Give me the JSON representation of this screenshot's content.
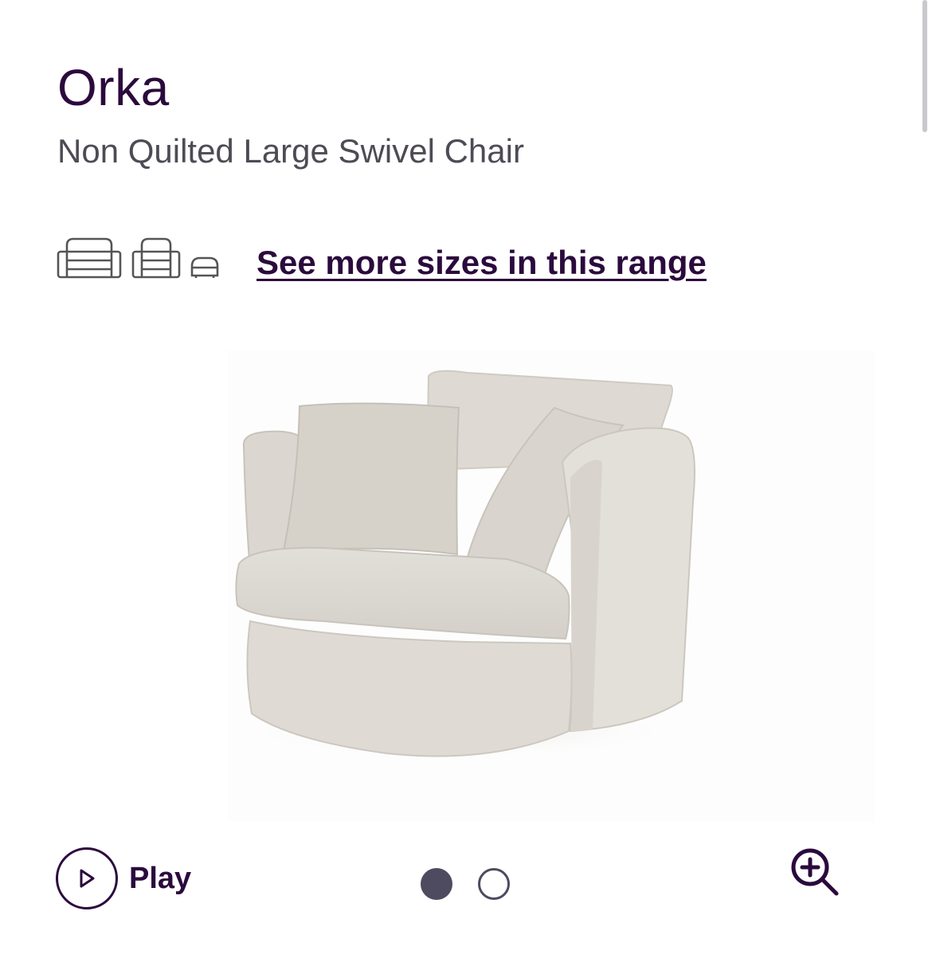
{
  "product": {
    "name": "Orka",
    "description": "Non Quilted Large Swivel Chair"
  },
  "range": {
    "link_label": "See more sizes in this range",
    "size_icons": [
      "sofa-icon",
      "armchair-icon",
      "footstool-icon"
    ]
  },
  "media": {
    "image_alt": "Orka Non Quilted Large Swivel Chair",
    "play_label": "Play",
    "slide_count": 2,
    "active_slide": 1
  },
  "colors": {
    "brand": "#2b0a3d",
    "text_secondary": "#4e4b55",
    "dot": "#4e4a5f",
    "upholstery": "#dcd8d1"
  },
  "icons": {
    "play": "play-icon",
    "zoom": "zoom-in-icon"
  }
}
